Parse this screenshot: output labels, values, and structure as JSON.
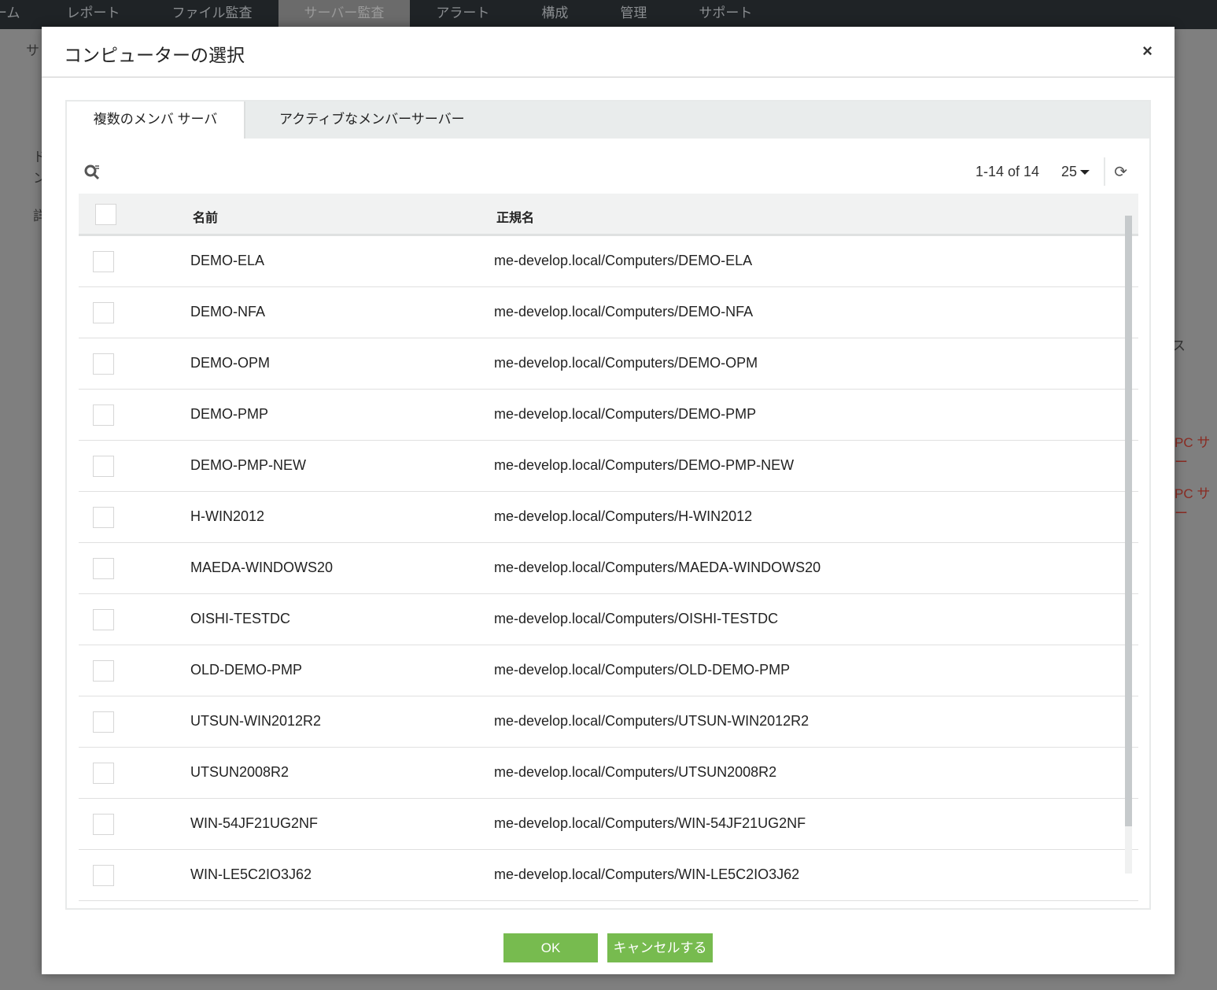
{
  "nav": {
    "items": [
      "ーム",
      "レポート",
      "ファイル監査",
      "サーバー監査",
      "アラート",
      "構成",
      "管理",
      "サポート"
    ],
    "active_index": 3
  },
  "background": {
    "fragments": [
      "サ",
      "ド",
      "ン",
      "詳",
      "ス",
      "PC サー",
      "PC サー"
    ]
  },
  "modal": {
    "title": "コンピューターの選択",
    "close_label": "×",
    "tabs": [
      {
        "label": "複数のメンバ サーバ",
        "active": true
      },
      {
        "label": "アクティブなメンバーサーバー",
        "active": false
      }
    ],
    "pager": {
      "range": "1-14 of 14",
      "per_page": "25"
    },
    "columns": [
      "名前",
      "正規名"
    ],
    "rows": [
      {
        "name": "DEMO-ELA",
        "canonical": "me-develop.local/Computers/DEMO-ELA"
      },
      {
        "name": "DEMO-NFA",
        "canonical": "me-develop.local/Computers/DEMO-NFA"
      },
      {
        "name": "DEMO-OPM",
        "canonical": "me-develop.local/Computers/DEMO-OPM"
      },
      {
        "name": "DEMO-PMP",
        "canonical": "me-develop.local/Computers/DEMO-PMP"
      },
      {
        "name": "DEMO-PMP-NEW",
        "canonical": "me-develop.local/Computers/DEMO-PMP-NEW"
      },
      {
        "name": "H-WIN2012",
        "canonical": "me-develop.local/Computers/H-WIN2012"
      },
      {
        "name": "MAEDA-WINDOWS20",
        "canonical": "me-develop.local/Computers/MAEDA-WINDOWS20"
      },
      {
        "name": "OISHI-TESTDC",
        "canonical": "me-develop.local/Computers/OISHI-TESTDC"
      },
      {
        "name": "OLD-DEMO-PMP",
        "canonical": "me-develop.local/Computers/OLD-DEMO-PMP"
      },
      {
        "name": "UTSUN-WIN2012R2",
        "canonical": "me-develop.local/Computers/UTSUN-WIN2012R2"
      },
      {
        "name": "UTSUN2008R2",
        "canonical": "me-develop.local/Computers/UTSUN2008R2"
      },
      {
        "name": "WIN-54JF21UG2NF",
        "canonical": "me-develop.local/Computers/WIN-54JF21UG2NF"
      },
      {
        "name": "WIN-LE5C2IO3J62",
        "canonical": "me-develop.local/Computers/WIN-LE5C2IO3J62"
      }
    ],
    "ok_label": "OK",
    "cancel_label": "キャンセルする"
  },
  "colors": {
    "accent": "#77bb4f",
    "nav_bg": "#1f2326"
  }
}
